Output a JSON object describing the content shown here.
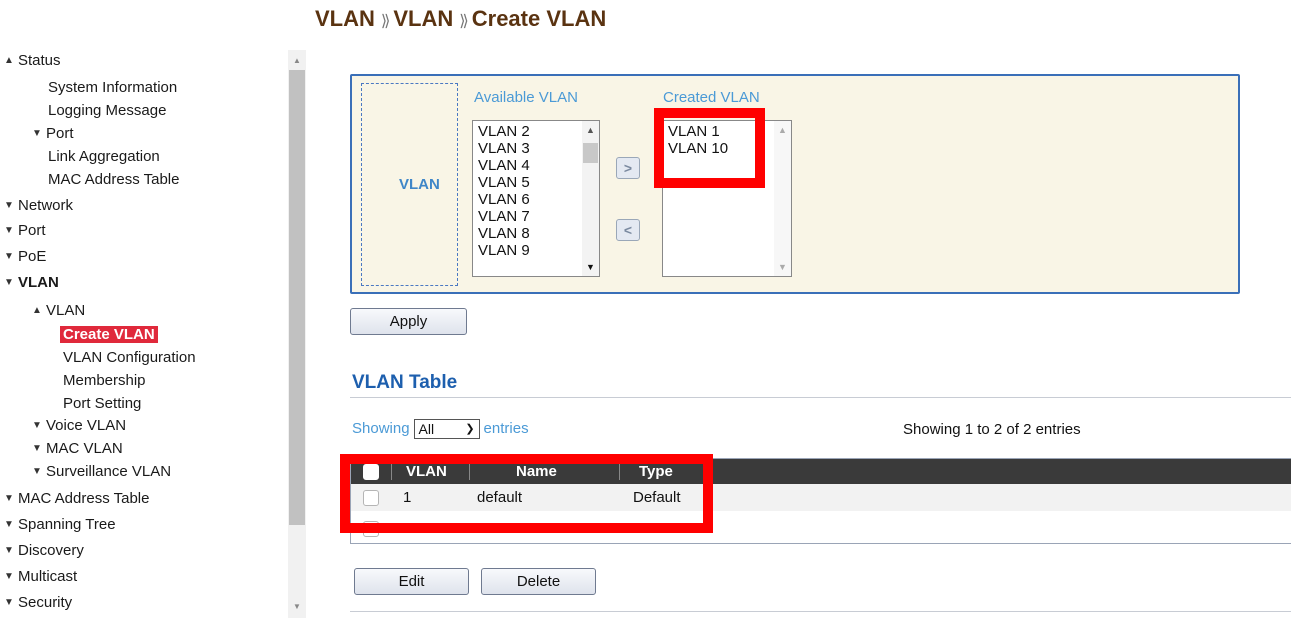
{
  "breadcrumb": [
    "VLAN",
    "VLAN",
    "Create VLAN"
  ],
  "sidebar": {
    "items": [
      {
        "label": "Status",
        "arrow": "up"
      },
      {
        "label": "System Information",
        "arrow": ""
      },
      {
        "label": "Logging Message",
        "arrow": ""
      },
      {
        "label": "Port",
        "arrow": "down"
      },
      {
        "label": "Link Aggregation",
        "arrow": ""
      },
      {
        "label": "MAC Address Table",
        "arrow": ""
      },
      {
        "label": "Network",
        "arrow": "down"
      },
      {
        "label": "Port",
        "arrow": "down"
      },
      {
        "label": "PoE",
        "arrow": "down"
      },
      {
        "label": "VLAN",
        "arrow": "down"
      },
      {
        "label": "VLAN",
        "arrow": "up"
      },
      {
        "label": "Create VLAN",
        "arrow": ""
      },
      {
        "label": "VLAN Configuration",
        "arrow": ""
      },
      {
        "label": "Membership",
        "arrow": ""
      },
      {
        "label": "Port Setting",
        "arrow": ""
      },
      {
        "label": "Voice VLAN",
        "arrow": "down"
      },
      {
        "label": "MAC VLAN",
        "arrow": "down"
      },
      {
        "label": "Surveillance VLAN",
        "arrow": "down"
      },
      {
        "label": "MAC Address Table",
        "arrow": "down"
      },
      {
        "label": "Spanning Tree",
        "arrow": "down"
      },
      {
        "label": "Discovery",
        "arrow": "down"
      },
      {
        "label": "Multicast",
        "arrow": "down"
      },
      {
        "label": "Security",
        "arrow": "down"
      }
    ]
  },
  "vlan_form": {
    "label": "VLAN",
    "available_title": "Available VLAN",
    "created_title": "Created VLAN",
    "available": [
      "VLAN 2",
      "VLAN 3",
      "VLAN 4",
      "VLAN 5",
      "VLAN 6",
      "VLAN 7",
      "VLAN 8",
      "VLAN 9"
    ],
    "created": [
      "VLAN 1",
      "VLAN 10"
    ],
    "add_glyph": ">",
    "remove_glyph": "<"
  },
  "apply_label": "Apply",
  "table": {
    "title": "VLAN Table",
    "showing_prefix": "Showing",
    "entries_value": "All",
    "showing_suffix": "entries",
    "summary": "Showing 1 to 2 of 2 entries",
    "columns": [
      "VLAN",
      "Name",
      "Type"
    ],
    "rows": [
      {
        "vlan": "1",
        "name": "default",
        "type": "Default"
      }
    ]
  },
  "actions": {
    "edit": "Edit",
    "delete": "Delete"
  },
  "colors": {
    "highlight": "#ff0000",
    "active_nav": "#e0293b",
    "panel_border": "#3a6fb8",
    "accent_blue": "#4b9ad6"
  }
}
